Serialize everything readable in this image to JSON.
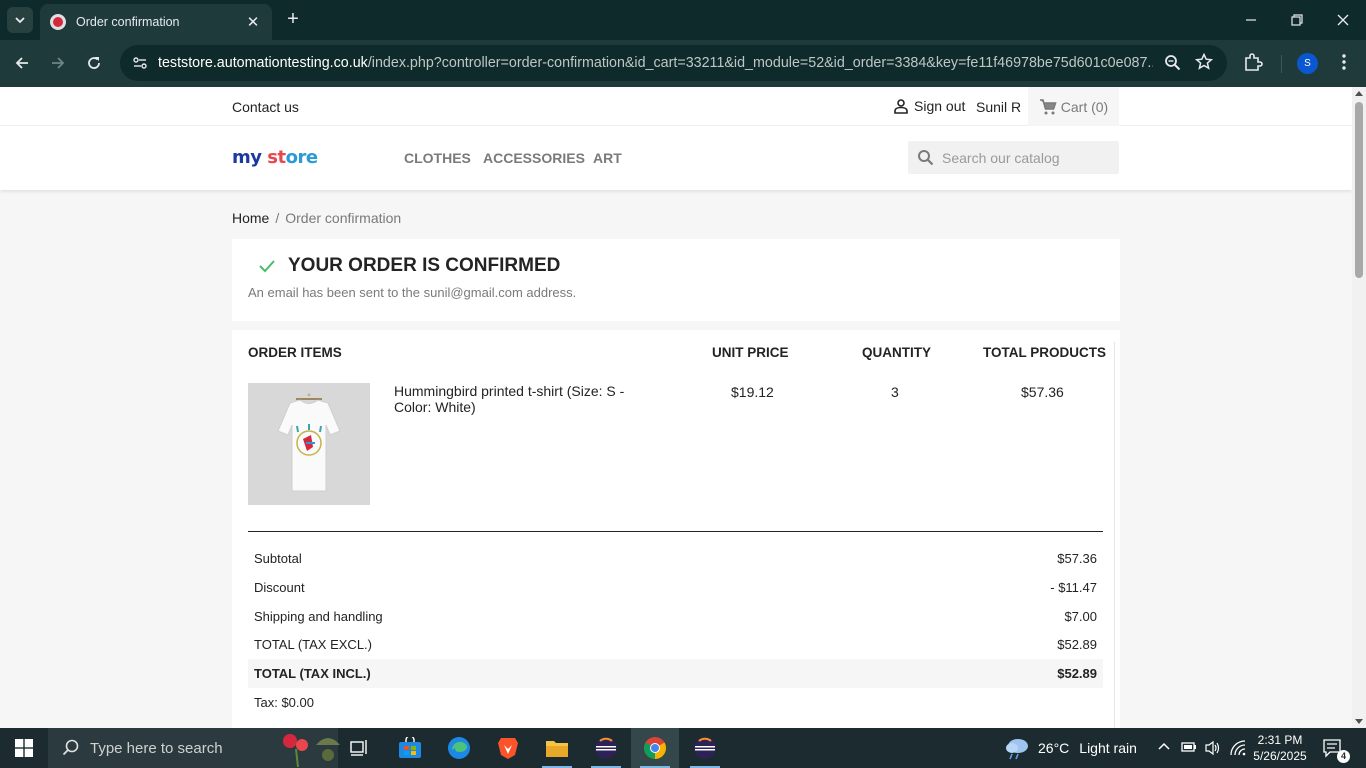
{
  "browser": {
    "tab_title": "Order confirmation",
    "url_host": "teststore.automationtesting.co.uk",
    "url_path": "/index.php?controller=order-confirmation&id_cart=33211&id_module=52&id_order=3384&key=fe11f46978be75d601c0e087...",
    "profile_initial": "S"
  },
  "header": {
    "contact_us": "Contact us",
    "sign_out": "Sign out",
    "username": "Sunil R",
    "cart": "Cart (0)"
  },
  "nav": {
    "logo_part1": "my",
    "logo_part2": " st",
    "logo_part3": "ore",
    "menu": [
      "CLOTHES",
      "ACCESSORIES",
      "ART"
    ],
    "search_placeholder": "Search our catalog"
  },
  "breadcrumb": {
    "home": "Home",
    "separator": "/",
    "current": "Order confirmation"
  },
  "confirmation": {
    "title": "YOUR ORDER IS CONFIRMED",
    "email_message": "An email has been sent to the sunil@gmail.com address."
  },
  "order_items": {
    "headers": {
      "items": "ORDER ITEMS",
      "unit_price": "UNIT PRICE",
      "quantity": "QUANTITY",
      "total_products": "TOTAL PRODUCTS"
    },
    "items": [
      {
        "name": "Hummingbird printed t-shirt (Size: S - Color: White)",
        "unit_price": "$19.12",
        "quantity": "3",
        "total": "$57.36"
      }
    ]
  },
  "summary": [
    {
      "label": "Subtotal",
      "value": "$57.36"
    },
    {
      "label": "Discount",
      "value": "- $11.47"
    },
    {
      "label": "Shipping and handling",
      "value": "$7.00"
    },
    {
      "label": "TOTAL (TAX EXCL.)",
      "value": "$52.89"
    },
    {
      "label": "TOTAL (TAX INCL.)",
      "value": "$52.89"
    }
  ],
  "tax_line": "Tax: $0.00",
  "taskbar": {
    "search_placeholder": "Type here to search",
    "temperature": "26°C",
    "weather": "Light rain",
    "time": "2:31 PM",
    "date": "5/26/2025",
    "notification_count": "4"
  },
  "colors": {
    "chrome_dark": "#0f2a2a",
    "chrome_toolbar": "#1e3a3a",
    "check_green": "#4cbb6c",
    "taskbar": "#1c2b2f"
  }
}
